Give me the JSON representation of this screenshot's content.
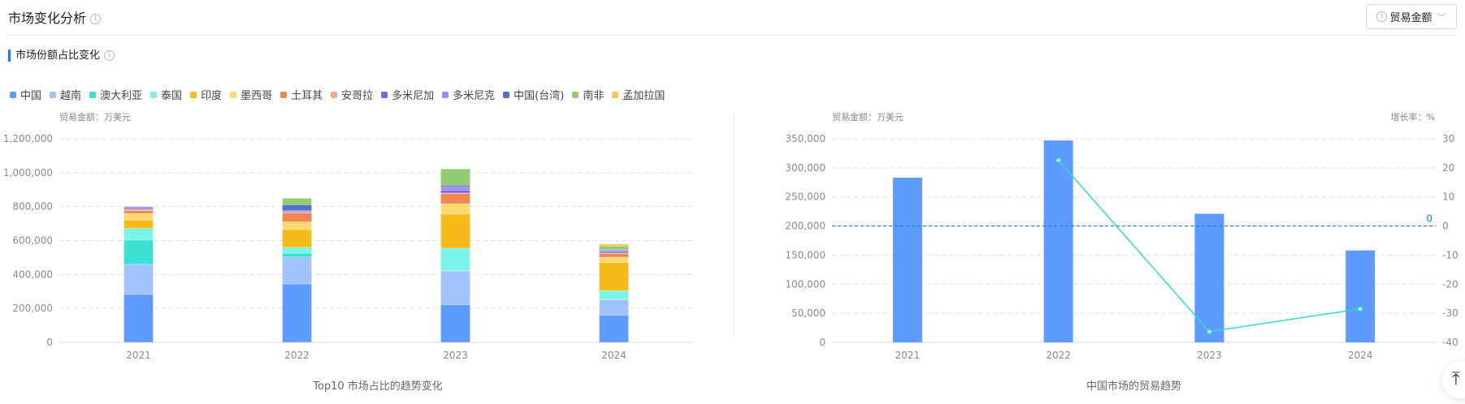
{
  "header": {
    "title": "市场变化分析",
    "info_icon": "info-circle-icon",
    "metric_select": {
      "value": "贸易金额",
      "icon": "info-circle-icon"
    }
  },
  "section": {
    "title": "市场份额占比变化"
  },
  "legend": [
    {
      "label": "中国",
      "color": "#5e9bff"
    },
    {
      "label": "越南",
      "color": "#a0c2ff"
    },
    {
      "label": "澳大利亚",
      "color": "#3ae0d2"
    },
    {
      "label": "泰国",
      "color": "#78f5e8"
    },
    {
      "label": "印度",
      "color": "#f5bb18"
    },
    {
      "label": "墨西哥",
      "color": "#ffd970"
    },
    {
      "label": "土耳其",
      "color": "#ee8752"
    },
    {
      "label": "安哥拉",
      "color": "#f2ad86"
    },
    {
      "label": "多米尼加",
      "color": "#7b61e5"
    },
    {
      "label": "多米尼克",
      "color": "#9c8ff0"
    },
    {
      "label": "中国(台湾)",
      "color": "#5470c6"
    },
    {
      "label": "南非",
      "color": "#91cc75"
    },
    {
      "label": "孟加拉国",
      "color": "#f6c75a"
    }
  ],
  "chart_data": [
    {
      "type": "bar",
      "stacked": true,
      "title": "Top10 市场占比的趋势变化",
      "ylabel": "贸易金额：万美元",
      "ylim": [
        0,
        1200000
      ],
      "yticks": [
        "0",
        "200,000",
        "400,000",
        "600,000",
        "800,000",
        "1,000,000",
        "1,200,000"
      ],
      "grid": true,
      "legend": "top-left",
      "categories": [
        "2021",
        "2022",
        "2023",
        "2024"
      ],
      "series": [
        {
          "name": "中国",
          "values": [
            282500,
            344000,
            221000,
            160000
          ]
        },
        {
          "name": "越南",
          "values": [
            177000,
            159000,
            200000,
            92000
          ]
        },
        {
          "name": "澳大利亚",
          "values": [
            143000,
            22000,
            2000,
            2000
          ]
        },
        {
          "name": "泰国",
          "values": [
            69000,
            35000,
            132000,
            51000
          ]
        },
        {
          "name": "印度",
          "values": [
            49000,
            105000,
            201000,
            165000
          ]
        },
        {
          "name": "墨西哥",
          "values": [
            39000,
            45000,
            61000,
            32000
          ]
        },
        {
          "name": "土耳其",
          "values": [
            16000,
            53000,
            60000,
            22000
          ]
        },
        {
          "name": "安哥拉",
          "values": [
            9000,
            4000,
            3000,
            2000
          ]
        },
        {
          "name": "多米尼加",
          "values": [
            7000,
            6000,
            16000,
            8000
          ]
        },
        {
          "name": "多米尼克",
          "values": [
            8000,
            3000,
            22000,
            9000
          ]
        },
        {
          "name": "中国(台湾)",
          "values": [
            0,
            35000,
            8000,
            2000
          ]
        },
        {
          "name": "南非",
          "values": [
            0,
            38000,
            96000,
            22000
          ]
        },
        {
          "name": "孟加拉国",
          "values": [
            0,
            0,
            0,
            13000
          ]
        }
      ]
    },
    {
      "type": "bar+line",
      "title": "中国市场的贸易趋势",
      "ylabel": "贸易金额：万美元",
      "y2label": "增长率：%",
      "ylim": [
        0,
        350000
      ],
      "y2lim": [
        -40,
        30
      ],
      "yticks": [
        "0",
        "50,000",
        "100,000",
        "150,000",
        "200,000",
        "250,000",
        "300,000",
        "350,000"
      ],
      "y2ticks": [
        "-40",
        "-30",
        "-20",
        "-10",
        "0",
        "10",
        "20",
        "30"
      ],
      "grid": true,
      "categories": [
        "2021",
        "2022",
        "2023",
        "2024"
      ],
      "bar_values": [
        283000,
        347000,
        221000,
        158000
      ],
      "bar_color": "#5e9bff",
      "growth_values": [
        null,
        22.6,
        -36.3,
        -28.5
      ],
      "line_color": "#2fdcc9",
      "mark_line": {
        "value": 0,
        "label": "0",
        "color": "#1677ff"
      }
    }
  ]
}
